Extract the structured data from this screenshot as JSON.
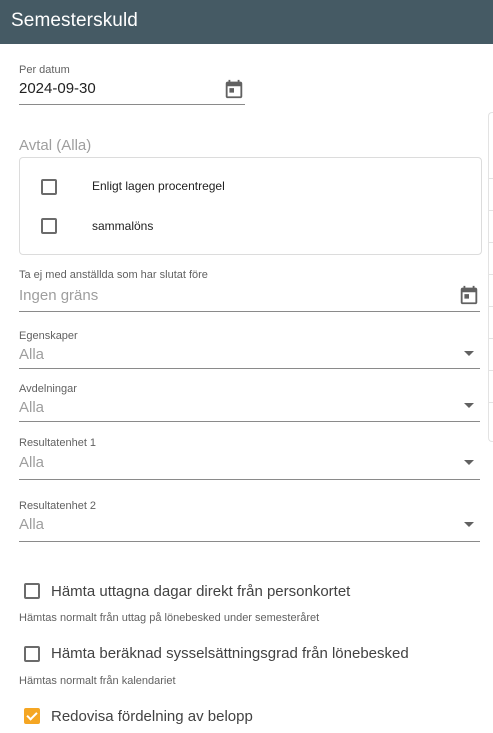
{
  "header": {
    "title": "Semesterskuld"
  },
  "per_datum": {
    "label": "Per datum",
    "value": "2024-09-30",
    "icon": "calendar-icon"
  },
  "avtal": {
    "title": "Avtal (Alla)",
    "options": [
      {
        "label": "Enligt lagen procentregel",
        "checked": false
      },
      {
        "label": "sammalöns",
        "checked": false
      }
    ]
  },
  "slutat": {
    "label": "Ta ej med anställda som har slutat före",
    "placeholder": "Ingen gräns",
    "icon": "calendar-icon"
  },
  "egenskaper": {
    "label": "Egenskaper",
    "value": "Alla"
  },
  "avdelningar": {
    "label": "Avdelningar",
    "value": "Alla"
  },
  "resultatenhet1": {
    "label": "Resultatenhet 1",
    "value": "Alla"
  },
  "resultatenhet2": {
    "label": "Resultatenhet 2",
    "value": "Alla"
  },
  "options": [
    {
      "label": "Hämta uttagna dagar direkt från personkortet",
      "hint": "Hämtas normalt från uttag på lönebesked under semesteråret",
      "checked": false
    },
    {
      "label": "Hämta beräknad sysselsättningsgrad från lönebesked",
      "hint": "Hämtas normalt från kalendariet",
      "checked": false
    },
    {
      "label": "Redovisa fördelning av belopp",
      "checked": true
    }
  ],
  "colors": {
    "header_bg": "#455a64",
    "accent": "#f5a623"
  }
}
